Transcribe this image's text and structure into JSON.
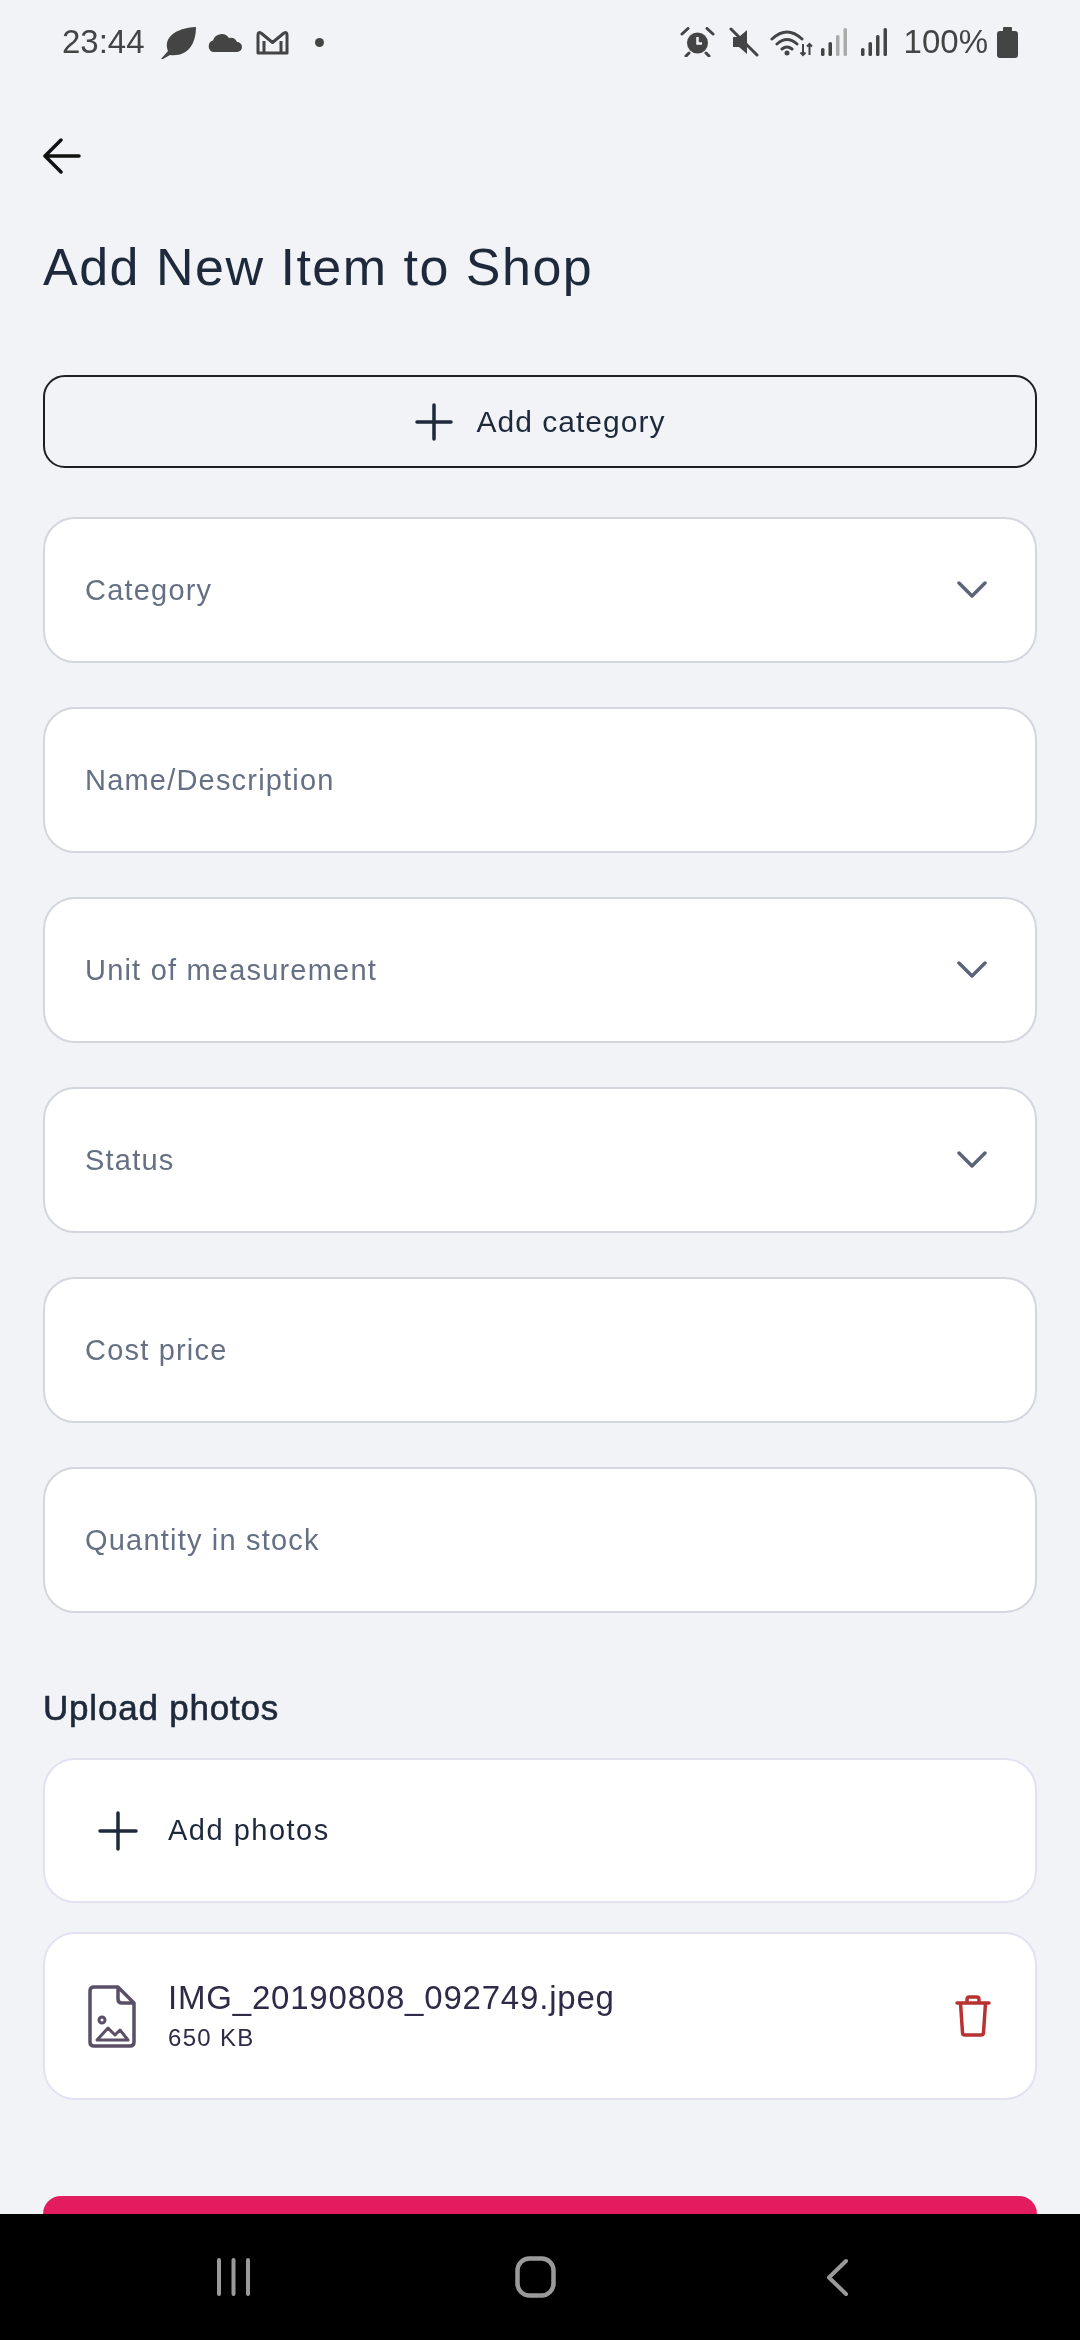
{
  "status_bar": {
    "time": "23:44",
    "battery": "100%"
  },
  "header": {
    "title": "Add New Item to Shop"
  },
  "add_category_button": {
    "label": "Add category"
  },
  "fields": [
    {
      "kind": "dropdown",
      "placeholder": "Category"
    },
    {
      "kind": "text",
      "placeholder": "Name/Description"
    },
    {
      "kind": "dropdown",
      "placeholder": "Unit of measurement"
    },
    {
      "kind": "dropdown",
      "placeholder": "Status"
    },
    {
      "kind": "text",
      "placeholder": "Cost price"
    },
    {
      "kind": "text",
      "placeholder": "Quantity in stock"
    }
  ],
  "upload": {
    "label": "Upload photos",
    "add_button": "Add photos",
    "files": [
      {
        "name": "IMG_20190808_092749.jpeg",
        "size": "650 KB"
      }
    ]
  }
}
